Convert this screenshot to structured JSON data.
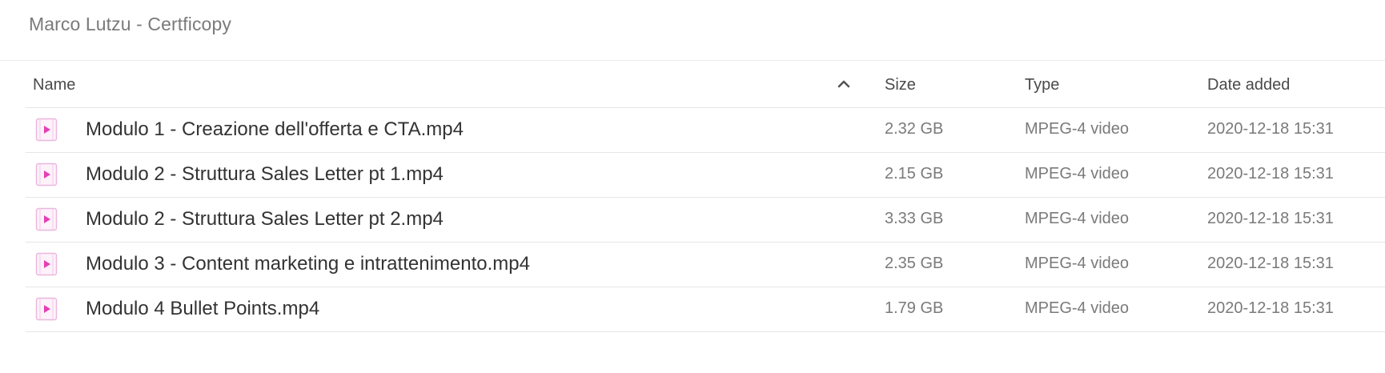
{
  "breadcrumb": "Marco Lutzu - Certficopy",
  "columns": {
    "name": "Name",
    "size": "Size",
    "type": "Type",
    "date": "Date added"
  },
  "sort": {
    "icon": "chevron-up-icon"
  },
  "file_icon": "video-file-icon",
  "accent_color": "#e53fb5",
  "files": [
    {
      "name": "Modulo 1 - Creazione dell'offerta e CTA.mp4",
      "size": "2.32 GB",
      "type": "MPEG-4 video",
      "date": "2020-12-18 15:31"
    },
    {
      "name": "Modulo 2 - Struttura Sales Letter pt 1.mp4",
      "size": "2.15 GB",
      "type": "MPEG-4 video",
      "date": "2020-12-18 15:31"
    },
    {
      "name": "Modulo 2 - Struttura Sales Letter pt 2.mp4",
      "size": "3.33 GB",
      "type": "MPEG-4 video",
      "date": "2020-12-18 15:31"
    },
    {
      "name": "Modulo 3 - Content marketing e intrattenimento.mp4",
      "size": "2.35 GB",
      "type": "MPEG-4 video",
      "date": "2020-12-18 15:31"
    },
    {
      "name": "Modulo 4 Bullet Points.mp4",
      "size": "1.79 GB",
      "type": "MPEG-4 video",
      "date": "2020-12-18 15:31"
    }
  ]
}
